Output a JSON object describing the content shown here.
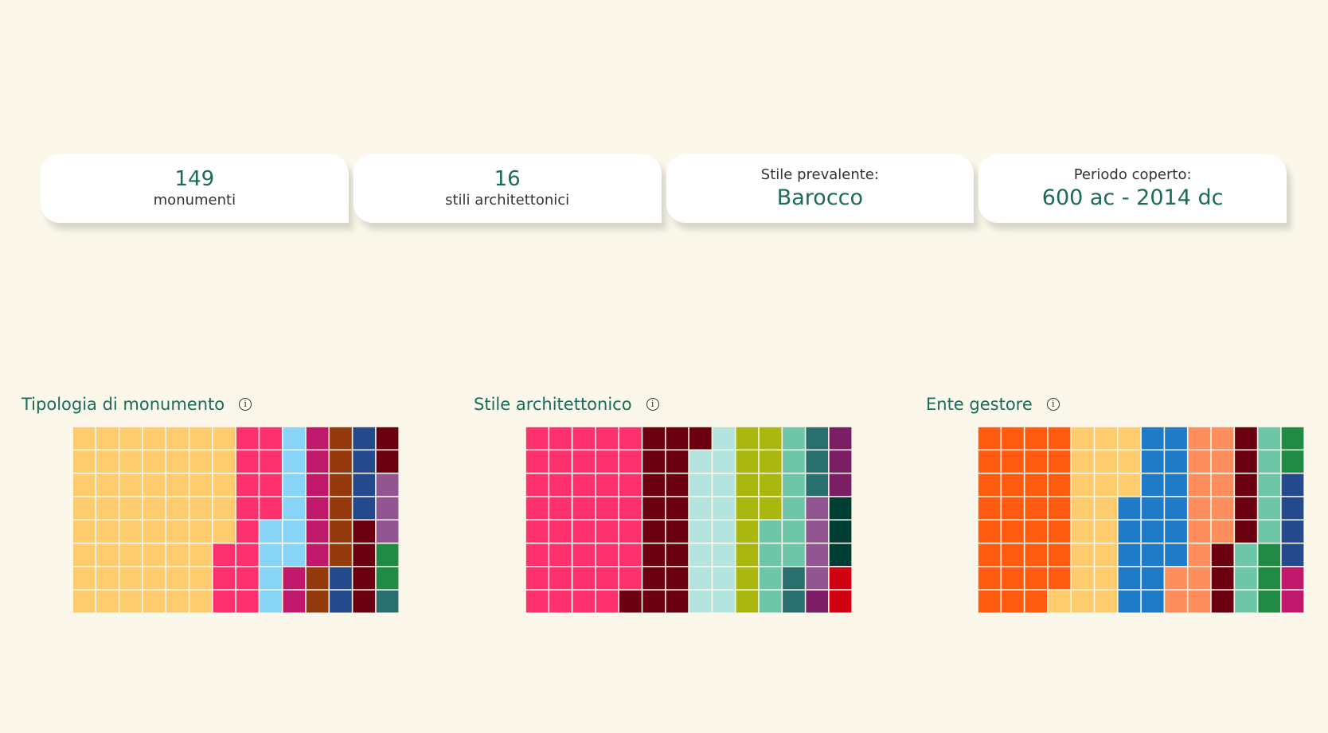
{
  "kpis": {
    "monuments_count": "149",
    "monuments_label": "monumenti",
    "styles_count": "16",
    "styles_label": "stili architettonici",
    "prevalent_label": "Stile prevalente:",
    "prevalent_value": "Barocco",
    "period_label": "Periodo coperto:",
    "period_value": "600 ac - 2014 dc"
  },
  "chart_data": [
    {
      "type": "waffle",
      "title": "Tipologia di monumento",
      "grid": {
        "rows": 8,
        "cols": 14,
        "fill_order": "column-major, top-to-bottom"
      },
      "segments": [
        {
          "count": 53,
          "color": "#fecb6e"
        },
        {
          "count": 15,
          "color": "#fe306d"
        },
        {
          "count": 10,
          "color": "#88d4f7"
        },
        {
          "count": 8,
          "color": "#c0186a"
        },
        {
          "count": 8,
          "color": "#953a0d"
        },
        {
          "count": 6,
          "color": "#244a8b"
        },
        {
          "count": 6,
          "color": "#6b0010"
        },
        {
          "count": 3,
          "color": "#925592"
        },
        {
          "count": 2,
          "color": "#218b45"
        },
        {
          "count": 1,
          "color": "#2a6f6f"
        }
      ]
    },
    {
      "type": "waffle",
      "title": "Stile architettonico",
      "grid": {
        "rows": 8,
        "cols": 14,
        "fill_order": "column-major, top-to-bottom"
      },
      "segments": [
        {
          "count": 39,
          "color": "#fe306d"
        },
        {
          "count": 18,
          "color": "#6b0010"
        },
        {
          "count": 15,
          "color": "#b3e5de"
        },
        {
          "count": 12,
          "color": "#a9b70e"
        },
        {
          "count": 10,
          "color": "#6ec6a8"
        },
        {
          "count": 5,
          "color": "#2a6f6f"
        },
        {
          "count": 4,
          "color": "#925592"
        },
        {
          "count": 4,
          "color": "#7b1e63"
        },
        {
          "count": 3,
          "color": "#003d33"
        },
        {
          "count": 3,
          "color": "#d10013"
        },
        {
          "count": 2,
          "color": "#ff8e5e"
        },
        {
          "count": 1,
          "color": "#88d4f7"
        },
        {
          "count": 1,
          "color": "#fecb6e"
        },
        {
          "count": 1,
          "color": "#953a0d"
        },
        {
          "count": 1,
          "color": "#ff5c12"
        }
      ]
    },
    {
      "type": "waffle",
      "title": "Ente gestore",
      "grid": {
        "rows": 8,
        "cols": 14,
        "fill_order": "column-major, top-to-bottom"
      },
      "segments": [
        {
          "count": 31,
          "color": "#ff5c12"
        },
        {
          "count": 20,
          "color": "#fecb6e"
        },
        {
          "count": 19,
          "color": "#1f7ac8"
        },
        {
          "count": 15,
          "color": "#ff8e5e"
        },
        {
          "count": 8,
          "color": "#6b0010"
        },
        {
          "count": 8,
          "color": "#6ec6a8"
        },
        {
          "count": 5,
          "color": "#218b45"
        },
        {
          "count": 4,
          "color": "#244a8b"
        },
        {
          "count": 3,
          "color": "#c0186a"
        }
      ]
    }
  ]
}
